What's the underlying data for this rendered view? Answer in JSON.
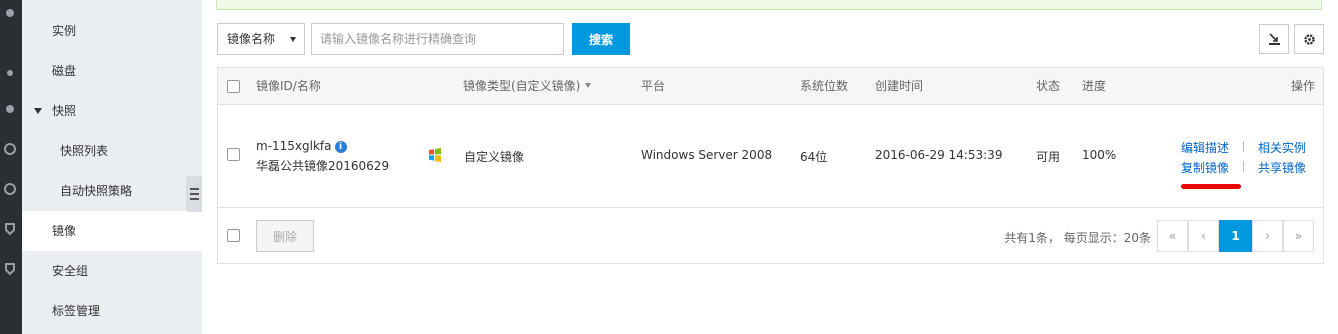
{
  "sidebar": {
    "items": [
      {
        "label": "实例"
      },
      {
        "label": "磁盘"
      },
      {
        "label": "快照"
      },
      {
        "label": "快照列表"
      },
      {
        "label": "自动快照策略"
      },
      {
        "label": "镜像"
      },
      {
        "label": "安全组"
      },
      {
        "label": "标签管理"
      }
    ]
  },
  "toolbar": {
    "filter_select": "镜像名称",
    "search_placeholder": "请输入镜像名称进行精确查询",
    "search_label": "搜索",
    "export_icon": "download-icon",
    "settings_icon": "gear-icon"
  },
  "table": {
    "headers": {
      "id_name": "镜像ID/名称",
      "type": "镜像类型(自定义镜像)",
      "platform": "平台",
      "bits": "系统位数",
      "created": "创建时间",
      "status": "状态",
      "progress": "进度",
      "actions": "操作"
    },
    "rows": [
      {
        "id": "m-115xglkfa",
        "name": "华磊公共镜像20160629",
        "os_icon": "windows-icon",
        "type": "自定义镜像",
        "platform": "Windows Server 2008",
        "bits": "64位",
        "created": "2016-06-29 14:53:39",
        "status": "可用",
        "progress": "100%",
        "actions": {
          "edit": "编辑描述",
          "related": "相关实例",
          "copy": "复制镜像",
          "share": "共享镜像"
        }
      }
    ]
  },
  "footer": {
    "delete_label": "删除",
    "page_info": "共有1条， 每页显示：20条",
    "pager": {
      "first": "«",
      "prev": "‹",
      "current": "1",
      "next": "›",
      "last": "»"
    }
  },
  "colors": {
    "primary": "#0099e0",
    "link": "#0066cc",
    "annotation": "#e00000"
  }
}
